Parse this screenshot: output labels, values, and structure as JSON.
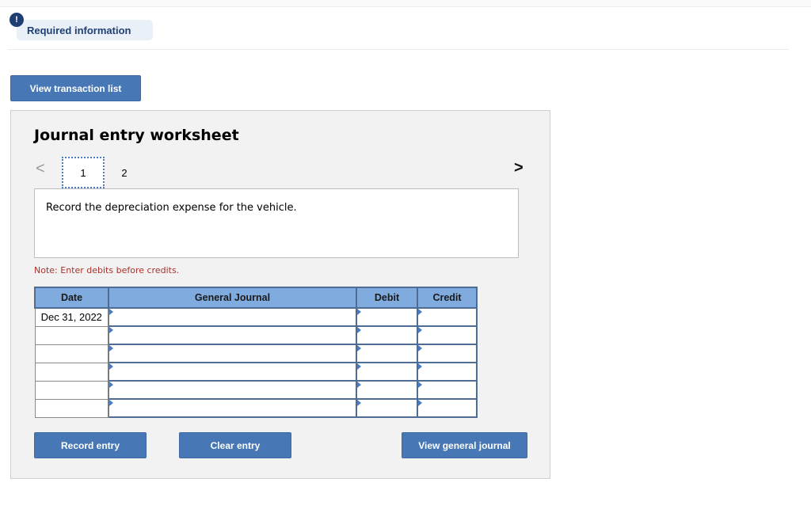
{
  "required_info": {
    "badge": "!",
    "label": "Required information"
  },
  "buttons": {
    "view_transaction_list": "View transaction list",
    "record_entry": "Record entry",
    "clear_entry": "Clear entry",
    "view_general_journal": "View general journal"
  },
  "worksheet": {
    "title": "Journal entry worksheet",
    "nav": {
      "prev": "<",
      "next": ">"
    },
    "tabs": [
      {
        "label": "1",
        "active": true
      },
      {
        "label": "2",
        "active": false
      }
    ],
    "description": "Record the depreciation expense for the vehicle.",
    "note": "Note: Enter debits before credits."
  },
  "journal": {
    "headers": {
      "date": "Date",
      "general_journal": "General Journal",
      "debit": "Debit",
      "credit": "Credit"
    },
    "rows": [
      {
        "date": "Dec 31, 2022",
        "account": "",
        "debit": "",
        "credit": ""
      },
      {
        "date": "",
        "account": "",
        "debit": "",
        "credit": ""
      },
      {
        "date": "",
        "account": "",
        "debit": "",
        "credit": ""
      },
      {
        "date": "",
        "account": "",
        "debit": "",
        "credit": ""
      },
      {
        "date": "",
        "account": "",
        "debit": "",
        "credit": ""
      },
      {
        "date": "",
        "account": "",
        "debit": "",
        "credit": ""
      }
    ]
  },
  "colors": {
    "accent": "#4777b5",
    "header_fill": "#7fabdf",
    "note_red": "#a8322b",
    "badge_navy": "#1f3f73"
  }
}
